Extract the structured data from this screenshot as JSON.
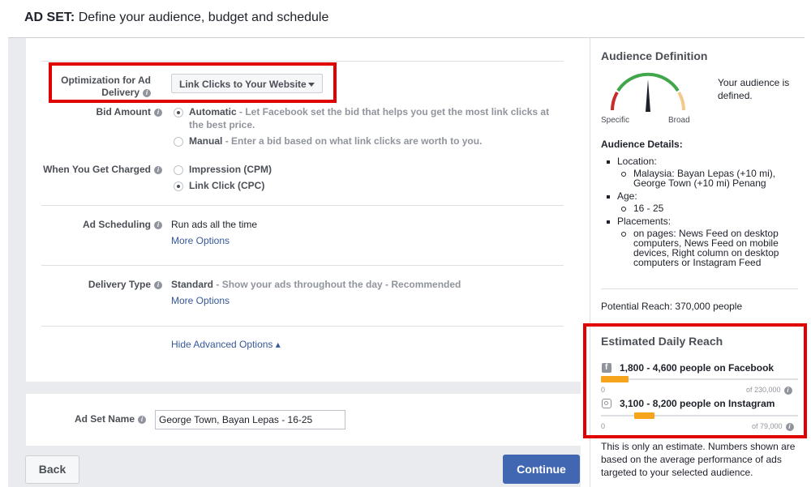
{
  "header": {
    "prefix": "AD SET:",
    "title": "Define your audience, budget and schedule"
  },
  "optimization": {
    "label": "Optimization for Ad Delivery",
    "selected": "Link Clicks to Your Website"
  },
  "bid_amount": {
    "label": "Bid Amount",
    "automatic_title": "Automatic",
    "automatic_desc": "- Let Facebook set the bid that helps you get the most link clicks at the best price.",
    "manual_title": "Manual",
    "manual_desc": "- Enter a bid based on what link clicks are worth to you."
  },
  "charged": {
    "label": "When You Get Charged",
    "option1": "Impression (CPM)",
    "option2": "Link Click (CPC)"
  },
  "scheduling": {
    "label": "Ad Scheduling",
    "value": "Run ads all the time",
    "more": "More Options"
  },
  "delivery_type": {
    "label": "Delivery Type",
    "value": "Standard",
    "desc": "- Show your ads throughout the day - Recommended",
    "more": "More Options"
  },
  "hide_advanced": "Hide Advanced Options ▴",
  "ad_set_name": {
    "label": "Ad Set Name",
    "value": "George Town, Bayan Lepas - 16-25"
  },
  "buttons": {
    "back": "Back",
    "continue": "Continue"
  },
  "audience": {
    "title": "Audience Definition",
    "defined_text": "Your audience is defined.",
    "specific": "Specific",
    "broad": "Broad",
    "details_title": "Audience Details:",
    "location_label": "Location:",
    "location_value": "Malaysia: Bayan Lepas (+10 mi), George Town (+10 mi) Penang",
    "age_label": "Age:",
    "age_value": "16 - 25",
    "placements_label": "Placements:",
    "placements_value": "on pages: News Feed on desktop computers, News Feed on mobile devices, Right column on desktop computers or Instagram Feed",
    "potential_reach": "Potential Reach: 370,000 people"
  },
  "daily_reach": {
    "title": "Estimated Daily Reach",
    "facebook_text": "1,800 - 4,600 people on Facebook",
    "facebook_min": "0",
    "facebook_max": "of 230,000",
    "facebook_range": [
      0.0,
      0.14
    ],
    "instagram_text": "3,100 - 8,200 people on Instagram",
    "instagram_min": "0",
    "instagram_max": "of 79,000",
    "instagram_range": [
      0.17,
      0.27
    ],
    "note": "This is only an estimate. Numbers shown are based on the average performance of ads targeted to your selected audience."
  },
  "colors": {
    "primary": "#4267b2",
    "bar": "#f7a41d",
    "highlight": "#e00000",
    "gauge_needle": "#1d2129"
  }
}
